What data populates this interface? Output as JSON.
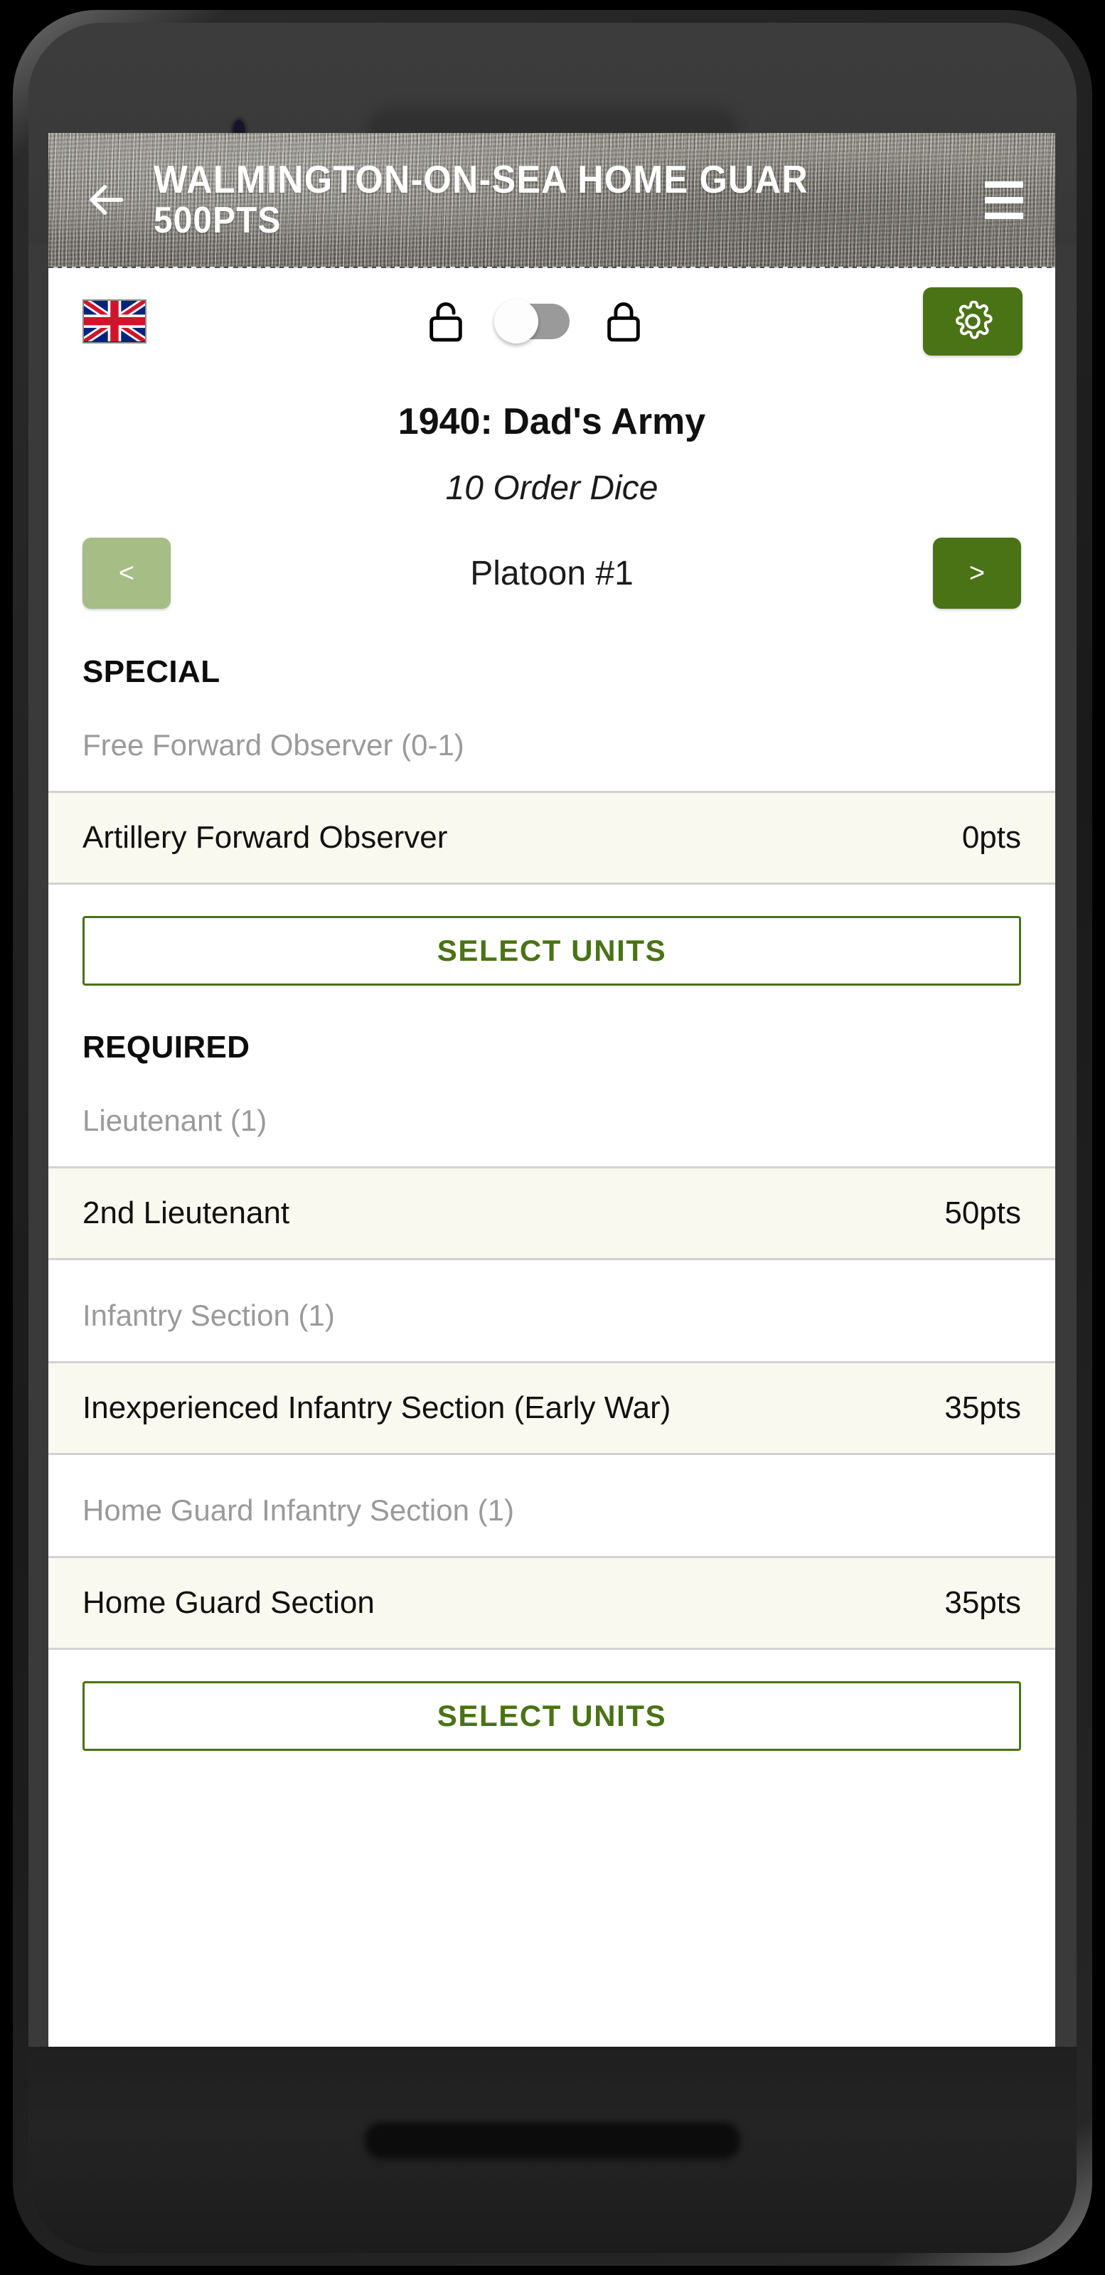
{
  "appbar": {
    "back_icon": "arrow-left-icon",
    "title": "WALMINGTON-ON-SEA HOME GUAR",
    "points": "500PTS",
    "menu_icon": "hamburger-menu-icon"
  },
  "controls": {
    "flag_icon": "union-jack-flag-icon",
    "unlock_icon": "unlock-icon",
    "lock_icon": "lock-icon",
    "toggle_state": "off",
    "settings_icon": "gear-icon"
  },
  "army": {
    "name": "1940: Dad's Army",
    "order_dice": "10 Order Dice"
  },
  "platoon": {
    "prev_label": "<",
    "label": "Platoon #1",
    "next_label": ">"
  },
  "sections": [
    {
      "heading": "SPECIAL",
      "slots": [
        {
          "label": "Free Forward Observer (0-1)",
          "units": [
            {
              "name": "Artillery Forward Observer",
              "points": "0pts"
            }
          ]
        }
      ],
      "select_units_label": "SELECT UNITS"
    },
    {
      "heading": "REQUIRED",
      "slots": [
        {
          "label": "Lieutenant (1)",
          "units": [
            {
              "name": "2nd Lieutenant",
              "points": "50pts"
            }
          ]
        },
        {
          "label": "Infantry Section (1)",
          "units": [
            {
              "name": "Inexperienced Infantry Section (Early War)",
              "points": "35pts"
            }
          ]
        },
        {
          "label": "Home Guard Infantry Section (1)",
          "units": [
            {
              "name": "Home Guard Section",
              "points": "35pts"
            }
          ]
        }
      ],
      "select_units_label": "SELECT UNITS"
    }
  ],
  "colors": {
    "accent_green": "#4a7316",
    "muted_green": "#a6bd85",
    "row_bg": "#faf9ef",
    "muted_text": "#9a9a9a"
  }
}
